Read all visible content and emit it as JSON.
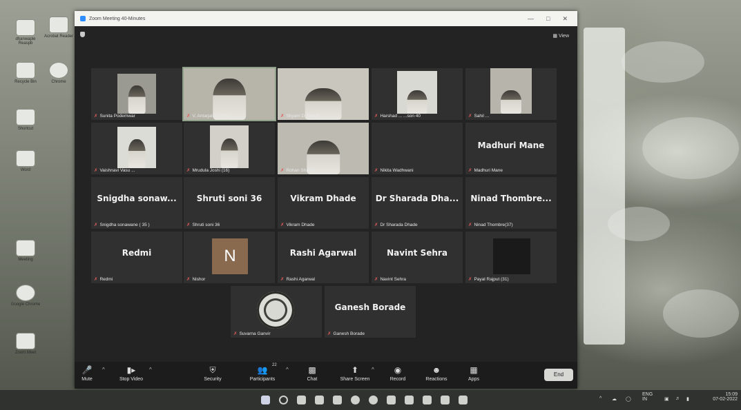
{
  "window": {
    "title": "Zoom Meeting 40-Minutes",
    "view_label": "View"
  },
  "participants": [
    {
      "display": "",
      "name": "Sunita Podemwar"
    },
    {
      "display": "",
      "name": "V. Antarjali (Sentia)"
    },
    {
      "display": "",
      "name": "Shyam D. Bandi"
    },
    {
      "display": "",
      "name": "Harshad ... ...son 40"
    },
    {
      "display": "",
      "name": "Sahil ..."
    },
    {
      "display": "",
      "name": "Vaishnavi Vasu ..."
    },
    {
      "display": "",
      "name": "Mrudula Joshi (16)"
    },
    {
      "display": "",
      "name": "Rohan Shaikh"
    },
    {
      "display": "",
      "name": "Nikita Wadhwani"
    },
    {
      "display": "Madhuri Mane",
      "name": "Madhuri Mane"
    },
    {
      "display": "Snigdha sonaw...",
      "name": "Snigdha sonawane ( 35 )"
    },
    {
      "display": "Shruti soni 36",
      "name": "Shruti soni 36"
    },
    {
      "display": "Vikram Dhade",
      "name": "Vikram Dhade"
    },
    {
      "display": "Dr Sharada Dha...",
      "name": "Dr Sharada Dhade"
    },
    {
      "display": "Ninad Thombre...",
      "name": "Ninad Thombre(37)"
    },
    {
      "display": "Redmi",
      "name": "Redmi"
    },
    {
      "display": "N",
      "name": "Nishor"
    },
    {
      "display": "Rashi Agarwal",
      "name": "Rashi Agarwal"
    },
    {
      "display": "Navint Sehra",
      "name": "Navint Sehra"
    },
    {
      "display": "",
      "name": "Payal Rajput (31)"
    },
    {
      "display": "",
      "name": "Suvarna Ganvir"
    },
    {
      "display": "Ganesh Borade",
      "name": "Ganesh Borade"
    }
  ],
  "toolbar": {
    "mute": "Mute",
    "stop_video": "Stop Video",
    "security": "Security",
    "participants": "Participants",
    "participants_count": "22",
    "chat": "Chat",
    "share_screen": "Share Screen",
    "record": "Record",
    "reactions": "Reactions",
    "apps": "Apps",
    "end": "End"
  },
  "tray": {
    "lang": "ENG",
    "region": "IN",
    "time": "15:09",
    "date": "07-02-2022"
  },
  "desktop_icons": [
    "dhanwaple Reaspb",
    "Acrobat Reader",
    "Recycle Bin",
    "Chrome",
    "Shortcut",
    "Word",
    "Meeting",
    "Google Chrome",
    "Zoom Meet"
  ]
}
